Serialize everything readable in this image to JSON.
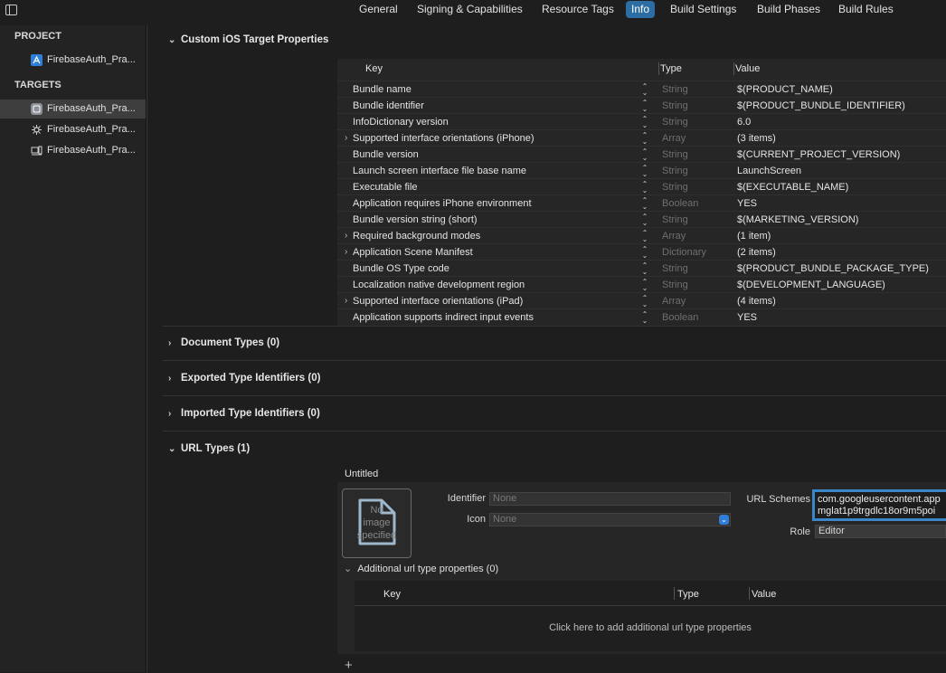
{
  "tabs": [
    "General",
    "Signing & Capabilities",
    "Resource Tags",
    "Info",
    "Build Settings",
    "Build Phases",
    "Build Rules"
  ],
  "active_tab": "Info",
  "sidebar": {
    "project_header": "PROJECT",
    "project_item": "FirebaseAuth_Pra...",
    "targets_header": "TARGETS",
    "targets": [
      "FirebaseAuth_Pra...",
      "FirebaseAuth_Pra...",
      "FirebaseAuth_Pra..."
    ]
  },
  "sections": {
    "custom": "Custom iOS Target Properties",
    "document_types": "Document Types (0)",
    "exported": "Exported Type Identifiers (0)",
    "imported": "Imported Type Identifiers (0)",
    "url_types": "URL Types (1)"
  },
  "table": {
    "headers": {
      "key": "Key",
      "type": "Type",
      "value": "Value"
    },
    "rows": [
      {
        "key": "Bundle name",
        "type": "String",
        "value": "$(PRODUCT_NAME)",
        "expandable": false
      },
      {
        "key": "Bundle identifier",
        "type": "String",
        "value": "$(PRODUCT_BUNDLE_IDENTIFIER)",
        "expandable": false
      },
      {
        "key": "InfoDictionary version",
        "type": "String",
        "value": "6.0",
        "expandable": false
      },
      {
        "key": "Supported interface orientations (iPhone)",
        "type": "Array",
        "value": "(3 items)",
        "expandable": true
      },
      {
        "key": "Bundle version",
        "type": "String",
        "value": "$(CURRENT_PROJECT_VERSION)",
        "expandable": false
      },
      {
        "key": "Launch screen interface file base name",
        "type": "String",
        "value": "LaunchScreen",
        "expandable": false
      },
      {
        "key": "Executable file",
        "type": "String",
        "value": "$(EXECUTABLE_NAME)",
        "expandable": false
      },
      {
        "key": "Application requires iPhone environment",
        "type": "Boolean",
        "value": "YES",
        "expandable": false
      },
      {
        "key": "Bundle version string (short)",
        "type": "String",
        "value": "$(MARKETING_VERSION)",
        "expandable": false
      },
      {
        "key": "Required background modes",
        "type": "Array",
        "value": "(1 item)",
        "expandable": true
      },
      {
        "key": "Application Scene Manifest",
        "type": "Dictionary",
        "value": "(2 items)",
        "expandable": true
      },
      {
        "key": "Bundle OS Type code",
        "type": "String",
        "value": "$(PRODUCT_BUNDLE_PACKAGE_TYPE)",
        "expandable": false
      },
      {
        "key": "Localization native development region",
        "type": "String",
        "value": "$(DEVELOPMENT_LANGUAGE)",
        "expandable": false
      },
      {
        "key": "Supported interface orientations (iPad)",
        "type": "Array",
        "value": "(4 items)",
        "expandable": true
      },
      {
        "key": "Application supports indirect input events",
        "type": "Boolean",
        "value": "YES",
        "expandable": false
      }
    ]
  },
  "url_type": {
    "title": "Untitled",
    "no_image_lines": [
      "No",
      "image",
      "specified"
    ],
    "identifier_label": "Identifier",
    "identifier_placeholder": "None",
    "icon_label": "Icon",
    "icon_value": "None",
    "url_schemes_label": "URL Schemes",
    "url_schemes_line1": "com.googleusercontent.app",
    "url_schemes_line2": "mglat1p9trgdlc18or9m5poi",
    "role_label": "Role",
    "role_value": "Editor",
    "additional_header": "Additional url type properties (0)",
    "sub_headers": {
      "key": "Key",
      "type": "Type",
      "value": "Value"
    },
    "empty_hint": "Click here to add additional url type properties",
    "add_symbol": "+"
  }
}
